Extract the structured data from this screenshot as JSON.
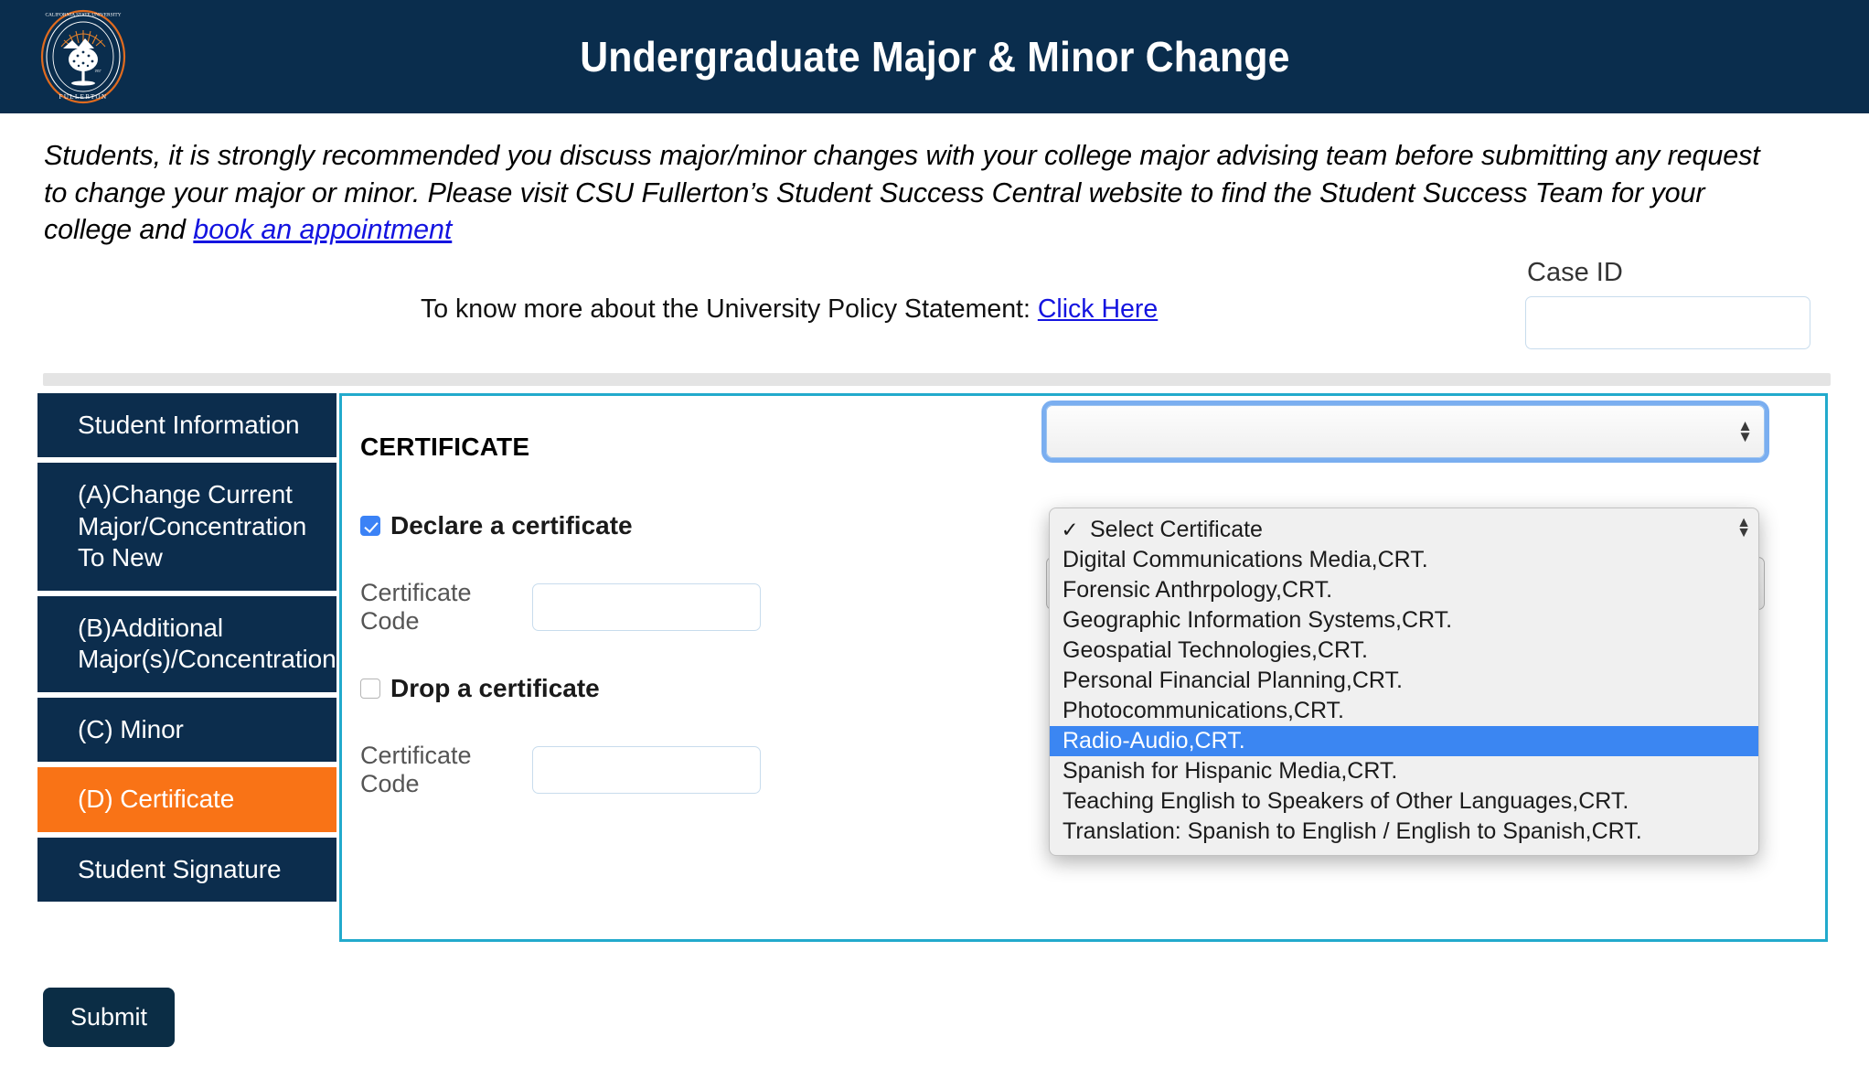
{
  "header": {
    "title": "Undergraduate Major & Minor Change",
    "logo_alt": "California State University Fullerton seal",
    "bg_color": "#0a2d4d"
  },
  "intro": {
    "line1_a": "Students, it is strongly recommended you discuss major/minor changes with your college major advising team before submitting any request to change your",
    "line2_a": "major or minor.  Please visit CSU Fullerton’s Student Success Central website to find the Student Success Team for your college and ",
    "link_label": "book an appointment"
  },
  "policy": {
    "text": "To know more about the University Policy Statement: ",
    "link_label": "Click Here"
  },
  "case": {
    "label": "Case ID",
    "value": "",
    "placeholder": ""
  },
  "sidebar": {
    "items": [
      {
        "label": "Student Information",
        "active": false
      },
      {
        "label": "(A)Change Current Major/Concentration To New",
        "active": false
      },
      {
        "label": "(B)Additional Major(s)/Concentration",
        "active": false
      },
      {
        "label": "(C) Minor",
        "active": false
      },
      {
        "label": "(D) Certificate",
        "active": true
      },
      {
        "label": "Student Signature",
        "active": false
      }
    ],
    "active_color": "#f97316",
    "bg_color": "#0c2d4d"
  },
  "main": {
    "section_title": "CERTIFICATE",
    "declare": {
      "label": "Declare a certificate",
      "checked": true,
      "code_label": "Certificate Code",
      "code_value": ""
    },
    "drop": {
      "label": "Drop a certificate",
      "checked": false,
      "code_label": "Certificate Code",
      "code_value": ""
    },
    "select_declare": {
      "value": "",
      "open": true
    },
    "select_drop": {
      "value": ""
    },
    "panel_border_color": "#22aacc"
  },
  "dropdown": {
    "selected": "Select Certificate",
    "highlighted": "Radio-Audio,CRT.",
    "options": [
      "Select Certificate",
      "Digital Communications Media,CRT.",
      "Forensic Anthrpology,CRT.",
      "Geographic Information Systems,CRT.",
      "Geospatial Technologies,CRT.",
      "Personal Financial Planning,CRT.",
      "Photocommunications,CRT.",
      "Radio-Audio,CRT.",
      "Spanish for Hispanic Media,CRT.",
      "Teaching English to Speakers of Other Languages,CRT.",
      "Translation: Spanish to English / English to Spanish,CRT."
    ],
    "check_glyph": "✓",
    "scroll_up_glyph": "▲",
    "scroll_down_glyph": "▼"
  },
  "footer": {
    "submit_label": "Submit"
  }
}
